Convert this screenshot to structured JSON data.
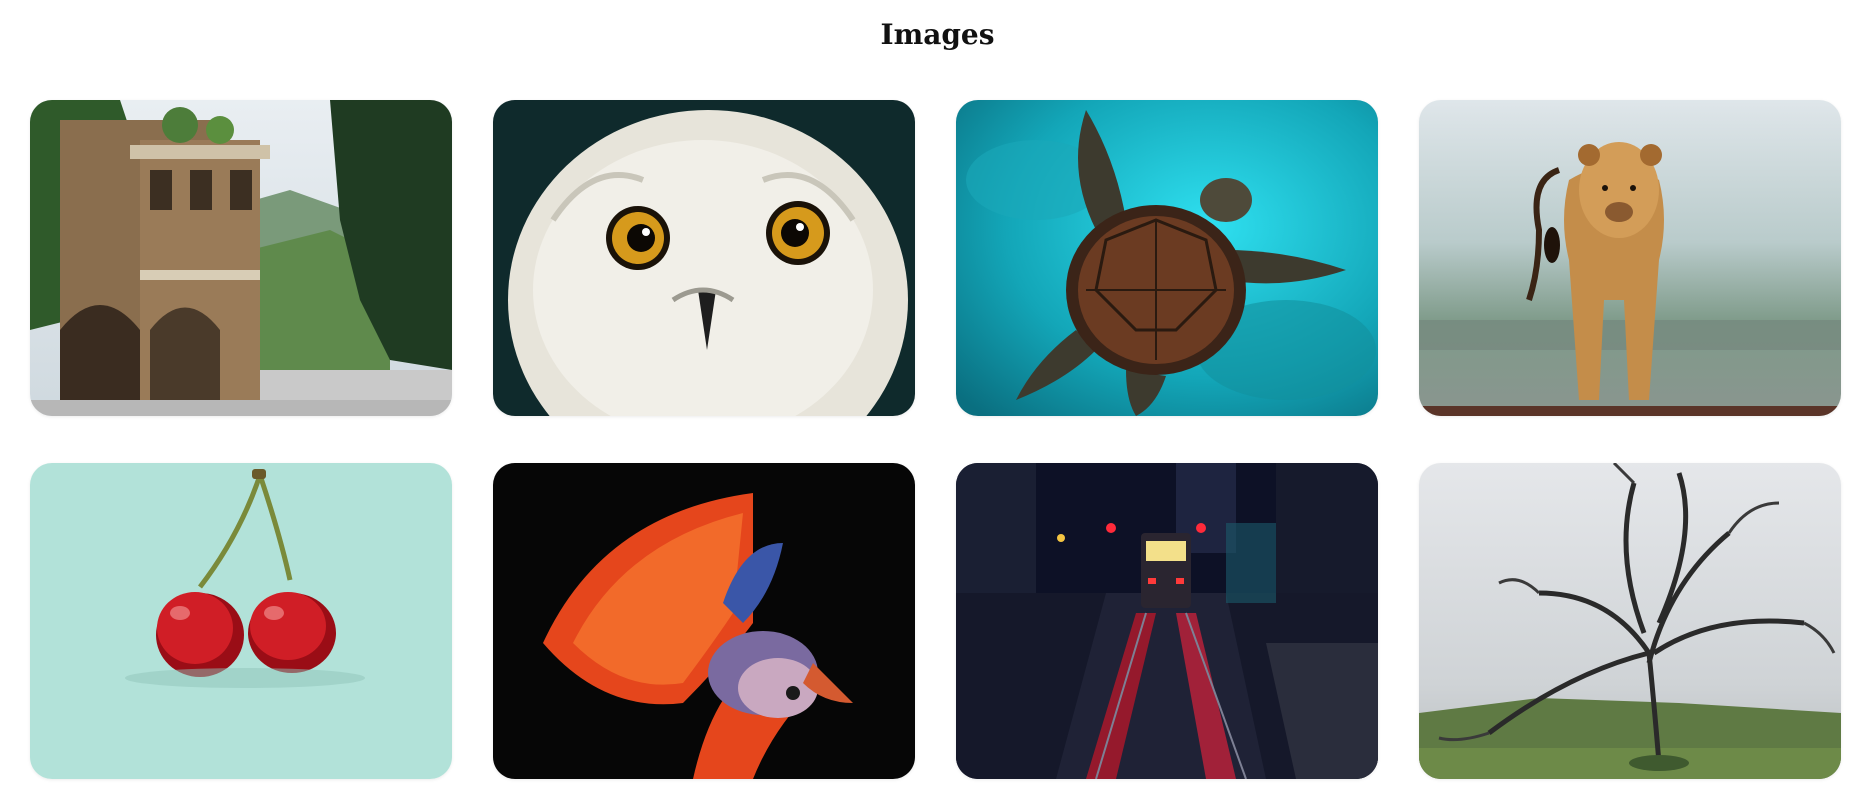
{
  "page": {
    "title": "Images"
  },
  "gallery": {
    "images": [
      {
        "subject": "stone-mansion"
      },
      {
        "subject": "snowy-owl"
      },
      {
        "subject": "sea-turtle"
      },
      {
        "subject": "lioness"
      },
      {
        "subject": "cherries"
      },
      {
        "subject": "betta-fish"
      },
      {
        "subject": "night-tram-street"
      },
      {
        "subject": "bare-tree-in-fog"
      }
    ]
  }
}
